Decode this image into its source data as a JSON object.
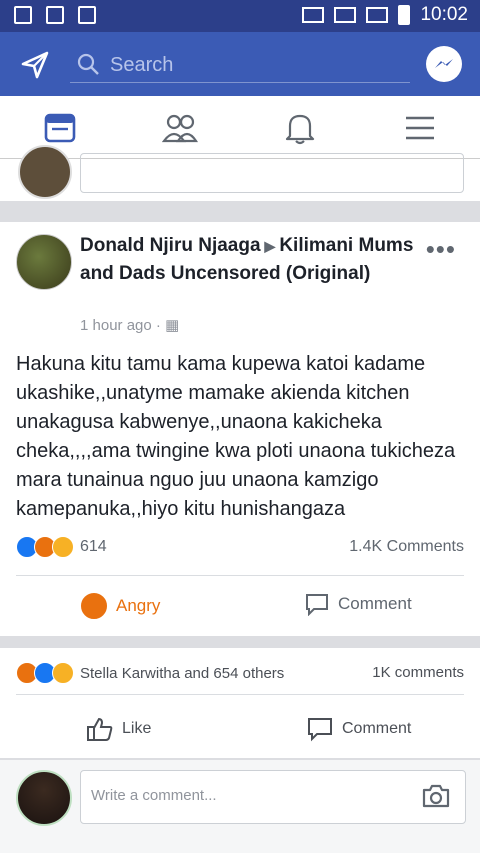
{
  "status_bar": {
    "time": "10:02"
  },
  "search": {
    "placeholder": "Search"
  },
  "post": {
    "author": "Donald Njiru Njaaga",
    "group": "Kilimani Mums and Dads Uncensored (Original)",
    "time": "1 hour ago",
    "dots": "•••",
    "text": "Hakuna kitu tamu kama kupewa katoi kadame ukashike,,unatyme mamake akienda kitchen unakagusa kabwenye,,unaona kakicheka cheka,,,,ama twingine kwa ploti unaona tukicheza mara tunainua nguo juu unaona kamzigo kamepanuka,,hiyo kitu hunishangaza",
    "reaction_count": "614",
    "comments_count": "1.4K Comments",
    "actions": {
      "react": "Angry",
      "comment": "Comment"
    }
  },
  "shared_bar": {
    "reactors": "Stella Karwitha and 654 others",
    "comments": "1K comments",
    "like": "Like",
    "comment": "Comment"
  },
  "write": {
    "placeholder": "Write a comment..."
  },
  "colors": {
    "brand": "#3b5bb5",
    "status": "#2c3f8a",
    "like_blue": "#1877f2",
    "angry": "#e9710f",
    "love": "#e0245e"
  }
}
